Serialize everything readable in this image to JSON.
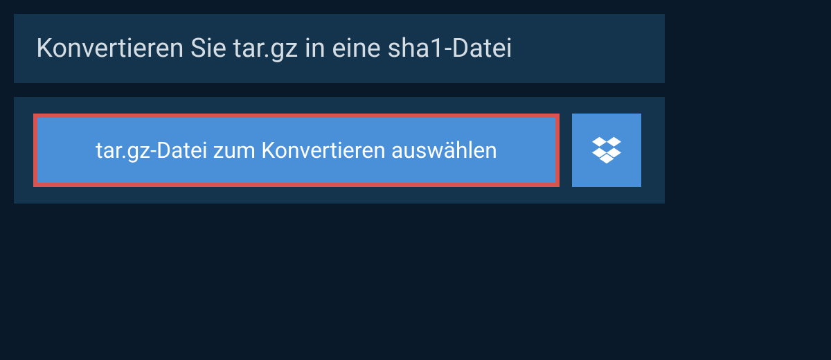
{
  "header": {
    "title": "Konvertieren Sie tar.gz in eine sha1-Datei"
  },
  "upload": {
    "select_file_label": "tar.gz-Datei zum Konvertieren auswählen"
  },
  "colors": {
    "background": "#0a1929",
    "panel": "#14344d",
    "button": "#4a90d9",
    "highlight_border": "#d9534f",
    "text_light": "#d5dde4",
    "text_white": "#ffffff"
  }
}
